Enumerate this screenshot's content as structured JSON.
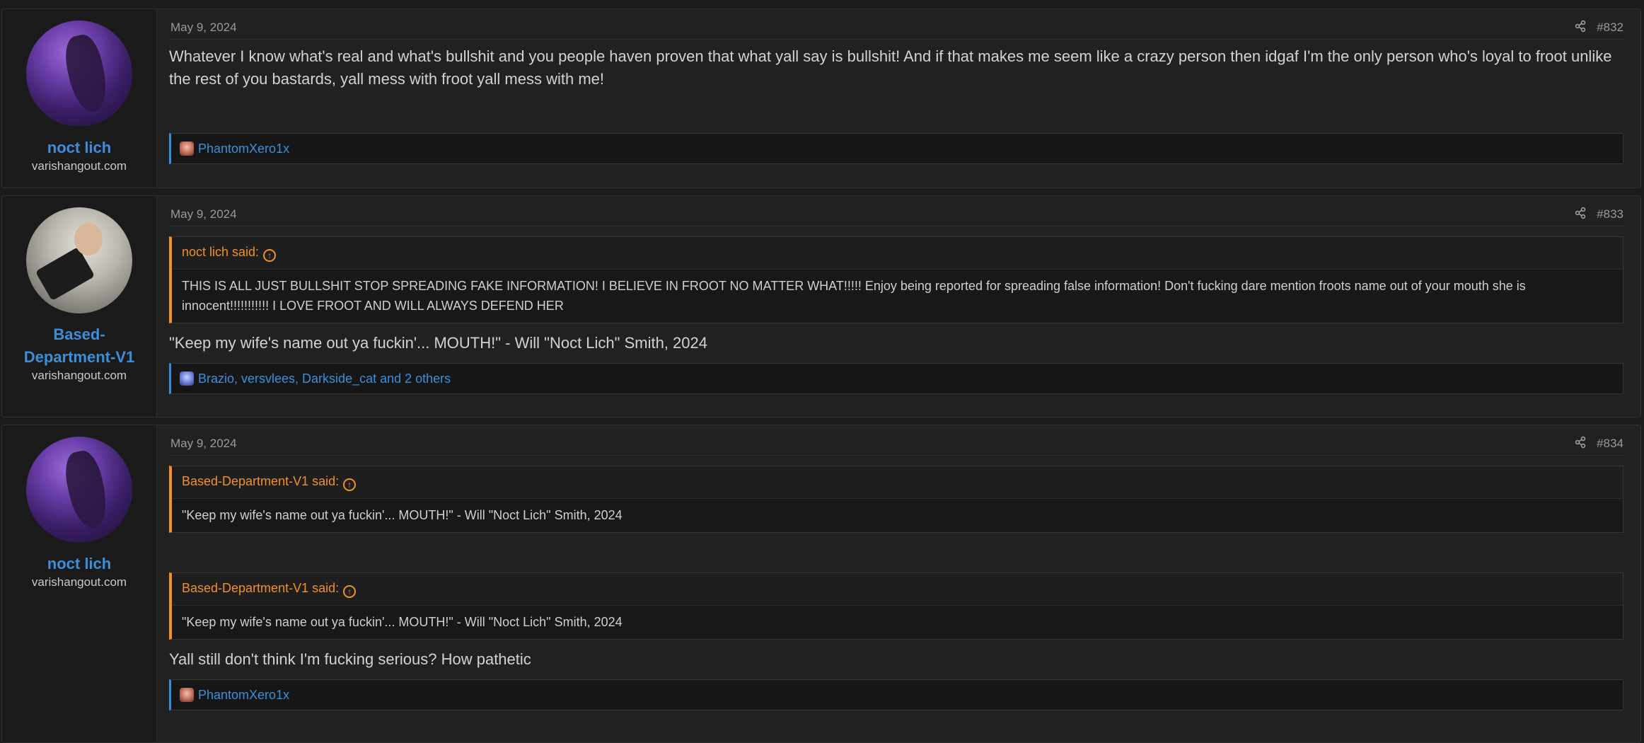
{
  "posts": [
    {
      "user": {
        "name": "noct lich",
        "title": "varishangout.com",
        "avatar": "purple-hooded-figure-avatar"
      },
      "date": "May 9, 2024",
      "number": "#832",
      "quotes": [],
      "body": "Whatever I know what's real and what's bullshit and you people haven proven that what yall say is bullshit! And if that makes me seem like a crazy person then idgaf I'm the only person who's loyal to froot unlike the rest of you bastards, yall mess with froot yall mess with me!",
      "reactions": "PhantomXero1x"
    },
    {
      "user": {
        "name": "Based-Department-V1",
        "title": "varishangout.com",
        "avatar": "man-holding-phone-avatar"
      },
      "date": "May 9, 2024",
      "number": "#833",
      "quotes": [
        {
          "author": "noct lich said:",
          "text": "THIS IS ALL JUST BULLSHIT STOP SPREADING FAKE INFORMATION! I BELIEVE IN FROOT NO MATTER WHAT!!!!! Enjoy being reported for spreading false information! Don't fucking dare mention froots name out of your mouth she is innocent!!!!!!!!!!! I LOVE FROOT AND WILL ALWAYS DEFEND HER"
        }
      ],
      "body": "\"Keep my wife's name out ya fuckin'... MOUTH!\" - Will \"Noct Lich\" Smith, 2024",
      "reactions": "Brazio, versvlees, Darkside_cat and 2 others"
    },
    {
      "user": {
        "name": "noct lich",
        "title": "varishangout.com",
        "avatar": "purple-hooded-figure-avatar"
      },
      "date": "May 9, 2024",
      "number": "#834",
      "quotes": [
        {
          "author": "Based-Department-V1 said:",
          "text": "\"Keep my wife's name out ya fuckin'... MOUTH!\" - Will \"Noct Lich\" Smith, 2024"
        },
        {
          "author": "Based-Department-V1 said:",
          "text": "\"Keep my wife's name out ya fuckin'... MOUTH!\" - Will \"Noct Lich\" Smith, 2024"
        }
      ],
      "body": "Yall still don't think I'm fucking serious? How pathetic",
      "reactions": "PhantomXero1x"
    }
  ],
  "colors": {
    "accent_blue": "#3b8fd9",
    "quote_orange": "#f0902c",
    "background": "#1b1b1b",
    "post_bg": "#212121"
  },
  "icons": {
    "share": "share-icon",
    "quote_jump": "arrow-up-circle-icon",
    "reaction": "reaction-icon"
  }
}
